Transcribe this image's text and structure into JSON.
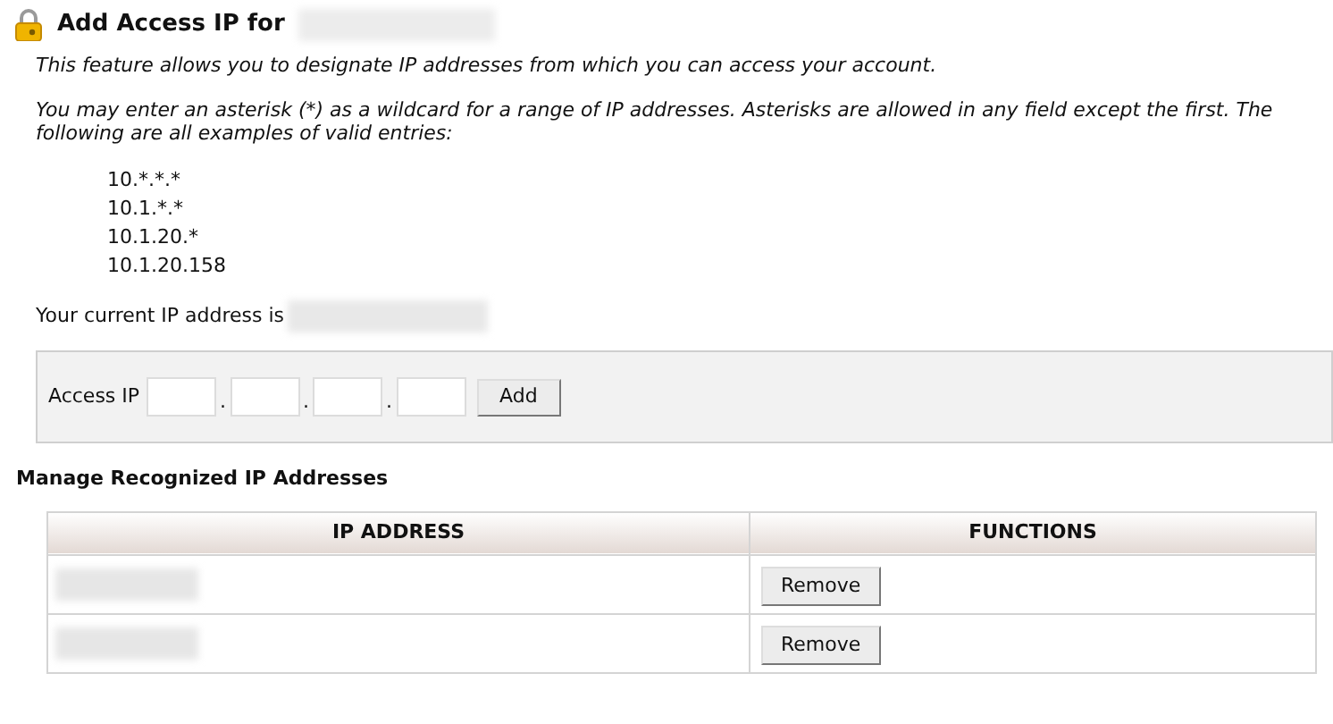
{
  "header": {
    "title": "Add Access IP for"
  },
  "intro": "This feature allows you to designate IP addresses from which you can access your account.",
  "wildcard_note": "You may enter an asterisk (*) as a wildcard for a range of IP addresses. Asterisks are allowed in any field except the first. The following are all examples of valid entries:",
  "examples": [
    "10.*.*.*",
    "10.1.*.*",
    "10.1.20.*",
    "10.1.20.158"
  ],
  "current_ip_label": "Your current IP address is",
  "access_form": {
    "label": "Access IP",
    "separators": [
      ".",
      ".",
      "."
    ],
    "button": "Add"
  },
  "manage": {
    "title": "Manage Recognized IP Addresses",
    "columns": [
      "IP ADDRESS",
      "FUNCTIONS"
    ],
    "rows": [
      {
        "button": "Remove"
      },
      {
        "button": "Remove"
      }
    ]
  }
}
